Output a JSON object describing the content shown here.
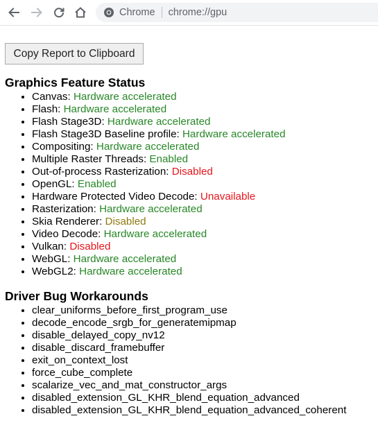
{
  "browser": {
    "omnibox_scheme": "Chrome",
    "omnibox_url": "chrome://gpu"
  },
  "page": {
    "copy_button_label": "Copy Report to Clipboard",
    "feature_status": {
      "heading": "Graphics Feature Status",
      "items": [
        {
          "name": "Canvas: ",
          "status": "Hardware accelerated",
          "state": "enabled"
        },
        {
          "name": "Flash: ",
          "status": "Hardware accelerated",
          "state": "enabled"
        },
        {
          "name": "Flash Stage3D: ",
          "status": "Hardware accelerated",
          "state": "enabled"
        },
        {
          "name": "Flash Stage3D Baseline profile: ",
          "status": "Hardware accelerated",
          "state": "enabled"
        },
        {
          "name": "Compositing: ",
          "status": "Hardware accelerated",
          "state": "enabled"
        },
        {
          "name": "Multiple Raster Threads: ",
          "status": "Enabled",
          "state": "enabled"
        },
        {
          "name": "Out-of-process Rasterization: ",
          "status": "Disabled",
          "state": "disabled"
        },
        {
          "name": "OpenGL: ",
          "status": "Enabled",
          "state": "enabled"
        },
        {
          "name": "Hardware Protected Video Decode: ",
          "status": "Unavailable",
          "state": "disabled"
        },
        {
          "name": "Rasterization: ",
          "status": "Hardware accelerated",
          "state": "enabled"
        },
        {
          "name": "Skia Renderer: ",
          "status": "Disabled",
          "state": "partial"
        },
        {
          "name": "Video Decode: ",
          "status": "Hardware accelerated",
          "state": "enabled"
        },
        {
          "name": "Vulkan: ",
          "status": "Disabled",
          "state": "disabled"
        },
        {
          "name": "WebGL: ",
          "status": "Hardware accelerated",
          "state": "enabled"
        },
        {
          "name": "WebGL2: ",
          "status": "Hardware accelerated",
          "state": "enabled"
        }
      ]
    },
    "workarounds": {
      "heading": "Driver Bug Workarounds",
      "items": [
        "clear_uniforms_before_first_program_use",
        "decode_encode_srgb_for_generatemipmap",
        "disable_delayed_copy_nv12",
        "disable_discard_framebuffer",
        "exit_on_context_lost",
        "force_cube_complete",
        "scalarize_vec_and_mat_constructor_args",
        "disabled_extension_GL_KHR_blend_equation_advanced",
        "disabled_extension_GL_KHR_blend_equation_advanced_coherent"
      ]
    }
  },
  "colors": {
    "enabled": "#278727",
    "disabled": "#e8141a",
    "partial": "#8f7a0f",
    "omnibox_bg": "#f1f3f4"
  },
  "icons": {
    "back": "back-arrow-icon",
    "forward": "forward-arrow-icon",
    "reload": "reload-icon",
    "home": "home-icon",
    "omnibox": "chrome-logo-icon"
  }
}
